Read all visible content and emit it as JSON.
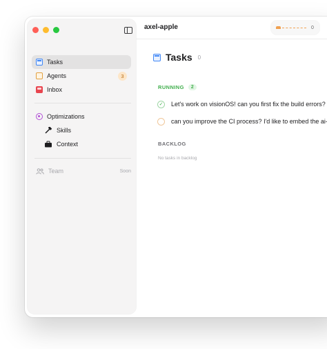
{
  "window": {
    "workspace_name": "axel-apple",
    "toolbar": {
      "count": "0"
    }
  },
  "sidebar": {
    "items": [
      {
        "label": "Tasks",
        "icon": "tasks-icon",
        "selected": true
      },
      {
        "label": "Agents",
        "icon": "agents-icon",
        "badge": "3"
      },
      {
        "label": "Inbox",
        "icon": "inbox-icon"
      }
    ],
    "optimizations": {
      "label": "Optimizations",
      "icon": "optimizations-icon",
      "children": [
        {
          "label": "Skills",
          "icon": "hammer-icon"
        },
        {
          "label": "Context",
          "icon": "briefcase-icon"
        }
      ]
    },
    "team": {
      "label": "Team",
      "icon": "people-icon",
      "status": "Soon"
    }
  },
  "main": {
    "title": "Tasks",
    "count": "0",
    "running": {
      "label": "RUNNING",
      "count": "2",
      "tasks": [
        {
          "text": "Let's work on visionOS! can you first fix the build errors?",
          "status": "done"
        },
        {
          "text": "can you improve the CI process? I'd like to embed the ai-",
          "status": "pending"
        }
      ]
    },
    "backlog": {
      "label": "BACKLOG",
      "empty_text": "No tasks in backlog"
    }
  },
  "colors": {
    "accent_blue": "#3f86f5",
    "running_green": "#3fae4b",
    "badge_orange": "#b86b12"
  }
}
